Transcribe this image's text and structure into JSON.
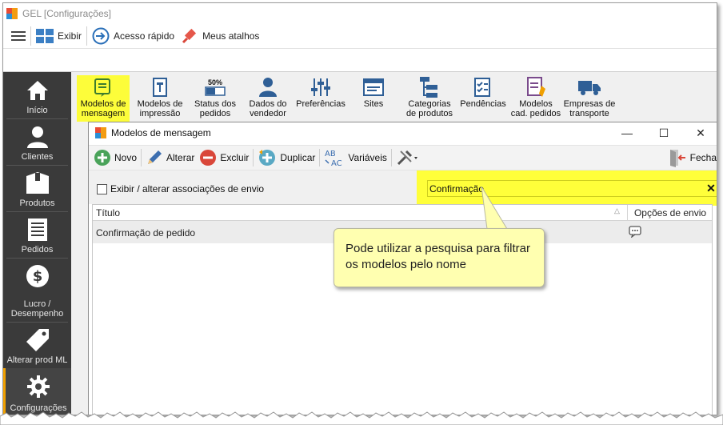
{
  "app": {
    "title": "GEL [Configurações]",
    "logo_colors": [
      "#e94b35",
      "#f39c12",
      "#2a8fd6",
      "#f39c12"
    ]
  },
  "toolbar": {
    "menu_icon": "hamburger-icon",
    "exibir_label": "Exibir",
    "acesso_rapido_label": "Acesso rápido",
    "meus_atalhos_label": "Meus atalhos"
  },
  "sidebar": {
    "items": [
      {
        "label": "Início",
        "icon": "home-icon"
      },
      {
        "label": "Clientes",
        "icon": "user-icon"
      },
      {
        "label": "Produtos",
        "icon": "box-icon"
      },
      {
        "label": "Pedidos",
        "icon": "receipt-icon"
      },
      {
        "label": "Lucro /",
        "label2": "Desempenho",
        "icon": "dollar-icon"
      },
      {
        "label": "Alterar prod ML",
        "icon": "tag-icon"
      },
      {
        "label": "Configurações",
        "icon": "gear-icon",
        "active": true
      }
    ]
  },
  "ribbon": {
    "items": [
      {
        "line1": "Modelos de",
        "line2": "mensagem",
        "selected": true
      },
      {
        "line1": "Modelos de",
        "line2": "impressão"
      },
      {
        "badge": "50%",
        "line1": "Status dos",
        "line2": "pedidos"
      },
      {
        "line1": "Dados do",
        "line2": "vendedor"
      },
      {
        "line1": "Preferências",
        "line2": ""
      },
      {
        "line1": "Sites",
        "line2": ""
      },
      {
        "line1": "Categorias",
        "line2": "de produtos"
      },
      {
        "line1": "Pendências",
        "line2": ""
      },
      {
        "line1": "Modelos",
        "line2": "cad. pedidos"
      },
      {
        "line1": "Empresas de",
        "line2": "transporte"
      }
    ]
  },
  "dialog": {
    "title": "Modelos de mensagem",
    "minimize": "—",
    "maximize": "☐",
    "close": "✕",
    "toolbar": {
      "novo": "Novo",
      "alterar": "Alterar",
      "excluir": "Excluir",
      "duplicar": "Duplicar",
      "variaveis": "Variáveis",
      "fechar": "Fechar"
    },
    "checkbox_label": "Exibir / alterar associações de envio",
    "search_value": "Confirmação",
    "search_clear": "✕",
    "grid": {
      "columns": [
        "Título",
        "Opções de envio"
      ],
      "sort_indicator": "△",
      "rows": [
        {
          "title": "Confirmação de pedido",
          "menu": "⋮"
        }
      ]
    }
  },
  "callout": {
    "text": "Pode utilizar a pesquisa para filtrar os modelos pelo nome"
  },
  "colors": {
    "highlight": "#ffff3a",
    "sidebar_bg": "#3a3a3a",
    "callout_bg": "#ffffb0",
    "accent_blue": "#2a6fb8"
  }
}
